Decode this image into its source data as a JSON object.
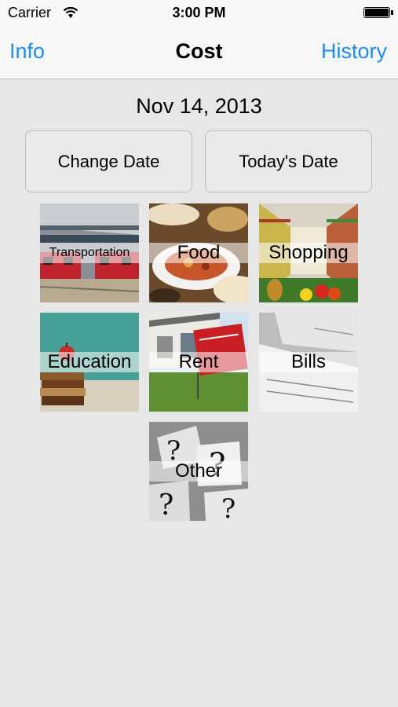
{
  "status": {
    "carrier": "Carrier",
    "time": "3:00 PM"
  },
  "nav": {
    "left_label": "Info",
    "title": "Cost",
    "right_label": "History"
  },
  "date": "Nov 14, 2013",
  "buttons": {
    "change_date": "Change Date",
    "todays_date": "Today's Date"
  },
  "categories": [
    {
      "label": "Transportation"
    },
    {
      "label": "Food"
    },
    {
      "label": "Shopping"
    },
    {
      "label": "Education"
    },
    {
      "label": "Rent"
    },
    {
      "label": "Bills"
    },
    {
      "label": "Other"
    }
  ],
  "colors": {
    "accent": "#1a8cff",
    "background": "#e7e7e7",
    "bar": "#f7f7f7"
  },
  "icons": {
    "wifi": "wifi-icon",
    "battery": "battery-icon"
  }
}
